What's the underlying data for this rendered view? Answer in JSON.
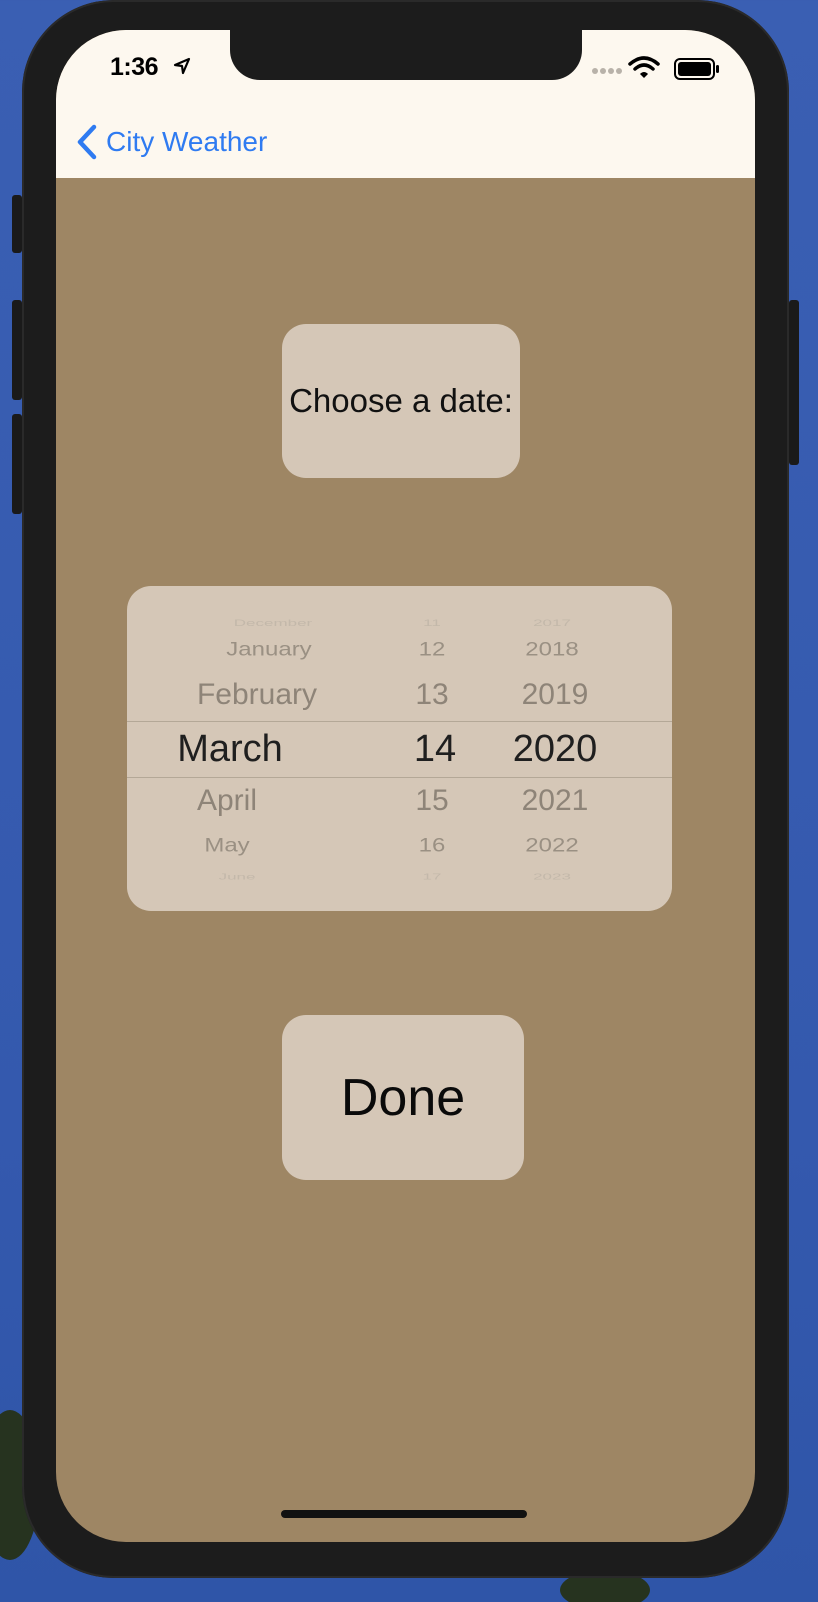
{
  "status_bar": {
    "time": "1:36",
    "location_icon": "location-arrow-icon",
    "signal_icon": "cellular-signal-icon",
    "wifi_icon": "wifi-icon",
    "battery_icon": "battery-icon"
  },
  "nav": {
    "back_label": "City Weather",
    "back_icon": "chevron-left-icon"
  },
  "prompt_label": "Choose a date:",
  "date_picker": {
    "months": [
      "December",
      "January",
      "February",
      "March",
      "April",
      "May",
      "June"
    ],
    "days": [
      "11",
      "12",
      "13",
      "14",
      "15",
      "16",
      "17"
    ],
    "years": [
      "2017",
      "2018",
      "2019",
      "2020",
      "2021",
      "2022",
      "2023"
    ],
    "selected": {
      "month": "March",
      "day": "14",
      "year": "2020"
    }
  },
  "done_button": "Done",
  "colors": {
    "background": "#9e8664",
    "panel": "#d5c7b7",
    "navbar": "#fdf8ef",
    "accent": "#2f7bf1"
  }
}
